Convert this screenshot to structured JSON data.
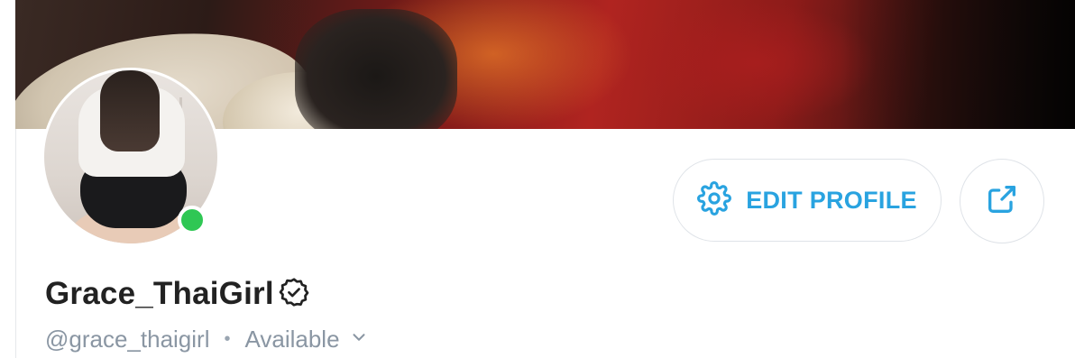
{
  "profile": {
    "display_name": "Grace_ThaiGirl",
    "username": "@grace_thaigirl",
    "separator": "•",
    "status": "Available",
    "verified": true,
    "online": true
  },
  "actions": {
    "edit_profile_label": "EDIT PROFILE",
    "edit_profile_icon": "gear-icon",
    "share_icon": "share-icon"
  },
  "colors": {
    "accent": "#29a3e0",
    "online": "#2fc754",
    "muted_text": "#8a96a3",
    "name_text": "#222222"
  }
}
